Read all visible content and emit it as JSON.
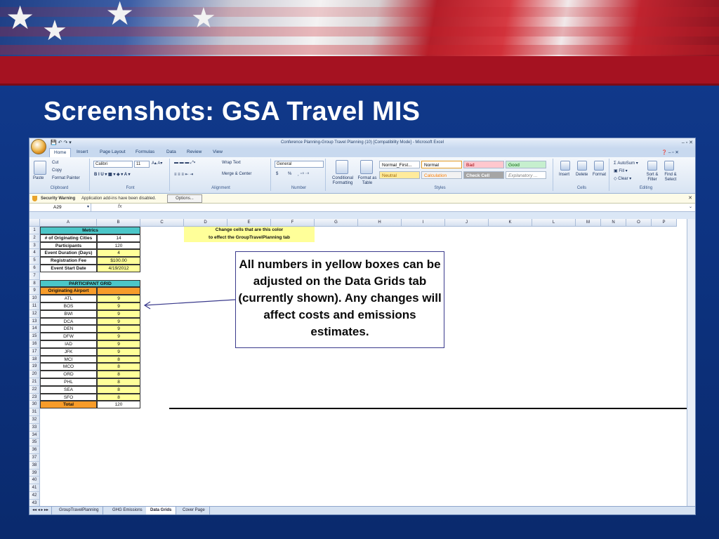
{
  "slide": {
    "title": "Screenshots: GSA Travel MIS",
    "callout": "All numbers in yellow boxes can be adjusted on the Data Grids tab (currently shown). Any changes will affect costs and emissions estimates."
  },
  "excel": {
    "window_title": "Conference Planning-Group Travel Planning (10)  [Compatibility Mode] - Microsoft Excel",
    "ribbon_tabs": [
      "Home",
      "Insert",
      "Page Layout",
      "Formulas",
      "Data",
      "Review",
      "View"
    ],
    "ribbon": {
      "clipboard": {
        "paste": "Paste",
        "cut": "Cut",
        "copy": "Copy",
        "format_painter": "Format Painter",
        "label": "Clipboard"
      },
      "font": {
        "name": "Calibri",
        "size": "11",
        "label": "Font"
      },
      "alignment": {
        "wrap": "Wrap Text",
        "merge": "Merge & Center",
        "label": "Alignment"
      },
      "number": {
        "format": "General",
        "currency": "$",
        "percent": "%",
        "label": "Number"
      },
      "styles": {
        "conditional": "Conditional Formatting",
        "format_table": "Format as Table",
        "cells": [
          {
            "name": "Normal_First...",
            "bg": "#ffffff",
            "fg": "#000000"
          },
          {
            "name": "Normal",
            "bg": "#ffffff",
            "fg": "#000000"
          },
          {
            "name": "Bad",
            "bg": "#ffc7ce",
            "fg": "#9c0006"
          },
          {
            "name": "Good",
            "bg": "#c6efce",
            "fg": "#006100"
          },
          {
            "name": "Neutral",
            "bg": "#ffeb9c",
            "fg": "#9c6500"
          },
          {
            "name": "Calculation",
            "bg": "#f2f2f2",
            "fg": "#fa7d00"
          },
          {
            "name": "Check Cell",
            "bg": "#a5a5a5",
            "fg": "#ffffff"
          },
          {
            "name": "Explanatory ...",
            "bg": "#ffffff",
            "fg": "#7f7f7f"
          }
        ],
        "label": "Styles"
      },
      "cells": {
        "insert": "Insert",
        "delete": "Delete",
        "format": "Format",
        "label": "Cells"
      },
      "editing": {
        "autosum": "AutoSum",
        "fill": "Fill",
        "clear": "Clear",
        "sort": "Sort & Filter",
        "find": "Find & Select",
        "label": "Editing"
      }
    },
    "security": {
      "label": "Security Warning",
      "message": "Application add-ins have been disabled.",
      "options": "Options..."
    },
    "name_box": "A29",
    "fx": "fx",
    "columns": [
      "A",
      "B",
      "C",
      "D",
      "E",
      "F",
      "G",
      "H",
      "I",
      "J",
      "K",
      "L",
      "M",
      "N",
      "O",
      "P"
    ],
    "rows": [
      "1",
      "2",
      "3",
      "4",
      "5",
      "6",
      "7",
      "8",
      "9",
      "10",
      "11",
      "12",
      "13",
      "14",
      "15",
      "16",
      "17",
      "18",
      "19",
      "20",
      "21",
      "22",
      "23",
      "30",
      "31",
      "32",
      "33",
      "34",
      "35",
      "36",
      "37",
      "38",
      "39",
      "40",
      "41",
      "42",
      "43"
    ],
    "note": [
      "Change cells that are this color",
      "to effect the GroupTravelPlanning tab"
    ],
    "metrics": {
      "header": "Metrics",
      "items": [
        {
          "label": "# of Originating Cities",
          "value": "14"
        },
        {
          "label": "Participants",
          "value": "120"
        },
        {
          "label": "Event Duration (Days)",
          "value": "4"
        },
        {
          "label": "Registration Fee",
          "value": "$100.00"
        },
        {
          "label": "Event Start Date",
          "value": "4/19/2012"
        }
      ]
    },
    "grid": {
      "header": "PARTICIPANT GRID",
      "subheader": "Originating Airport",
      "airports": [
        {
          "code": "ATL",
          "count": "9"
        },
        {
          "code": "BOS",
          "count": "9"
        },
        {
          "code": "BWI",
          "count": "9"
        },
        {
          "code": "DCA",
          "count": "9"
        },
        {
          "code": "DEN",
          "count": "9"
        },
        {
          "code": "DFW",
          "count": "9"
        },
        {
          "code": "IAD",
          "count": "9"
        },
        {
          "code": "JFK",
          "count": "9"
        },
        {
          "code": "MCI",
          "count": "8"
        },
        {
          "code": "MCO",
          "count": "8"
        },
        {
          "code": "ORD",
          "count": "8"
        },
        {
          "code": "PHL",
          "count": "8"
        },
        {
          "code": "SEA",
          "count": "8"
        },
        {
          "code": "SFO",
          "count": "8"
        }
      ],
      "total_label": "Total",
      "total_value": "120"
    },
    "sheet_tabs": [
      "GroupTravelPlanning",
      "GHG Emissions",
      "Data Grids",
      "Cover Page"
    ],
    "active_sheet": "Data Grids"
  }
}
